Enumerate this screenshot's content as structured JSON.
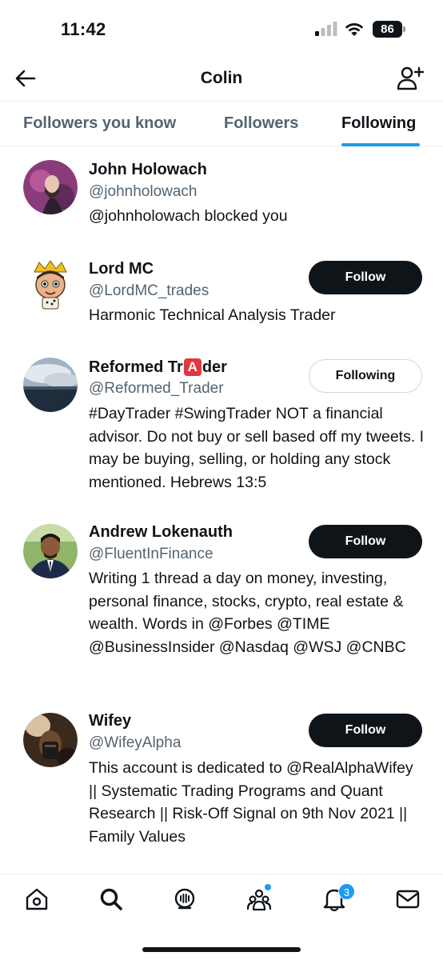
{
  "status_bar": {
    "time": "11:42",
    "battery": "86"
  },
  "header": {
    "title": "Colin",
    "back_icon": "arrow-left-icon",
    "action_icon": "add-user-icon"
  },
  "tabs": [
    {
      "label": "Followers you know",
      "active": false
    },
    {
      "label": "Followers",
      "active": false
    },
    {
      "label": "Following",
      "active": true
    }
  ],
  "users": [
    {
      "name": "John Holowach",
      "handle": "@johnholowach",
      "bio": "@johnholowach blocked you",
      "button": ""
    },
    {
      "name": "Lord MC",
      "handle": "@LordMC_trades",
      "bio": "Harmonic Technical Analysis Trader",
      "button": "Follow"
    },
    {
      "name_prefix": "Reformed Tr",
      "name_emoji": "A",
      "name_suffix": "der",
      "handle": "@Reformed_Trader",
      "bio": "#DayTrader #SwingTrader NOT a financial advisor. Do not buy or sell based off my tweets. I may be buying, selling, or holding any stock mentioned. Hebrews 13:5",
      "button": "Following"
    },
    {
      "name": "Andrew Lokenauth",
      "handle": "@FluentInFinance",
      "bio": "Writing 1 thread a day on money, investing, personal finance, stocks, crypto, real estate & wealth. Words in @Forbes @TIME @BusinessInsider @Nasdaq @WSJ @CNBC",
      "button": "Follow"
    },
    {
      "name": "Wifey",
      "handle": "@WifeyAlpha",
      "bio": "This account is dedicated to @RealAlphaWifey || Systematic Trading Programs and Quant Research || Risk-Off Signal on 9th Nov 2021 || Family Values",
      "button": "Follow"
    }
  ],
  "bottom_nav": {
    "items": [
      "home-icon",
      "search-icon",
      "spaces-icon",
      "communities-icon",
      "notifications-icon",
      "messages-icon"
    ],
    "notifications_badge": "3"
  },
  "colors": {
    "accent": "#1d9bf0",
    "text": "#0f1419",
    "secondary_text": "#536471"
  }
}
